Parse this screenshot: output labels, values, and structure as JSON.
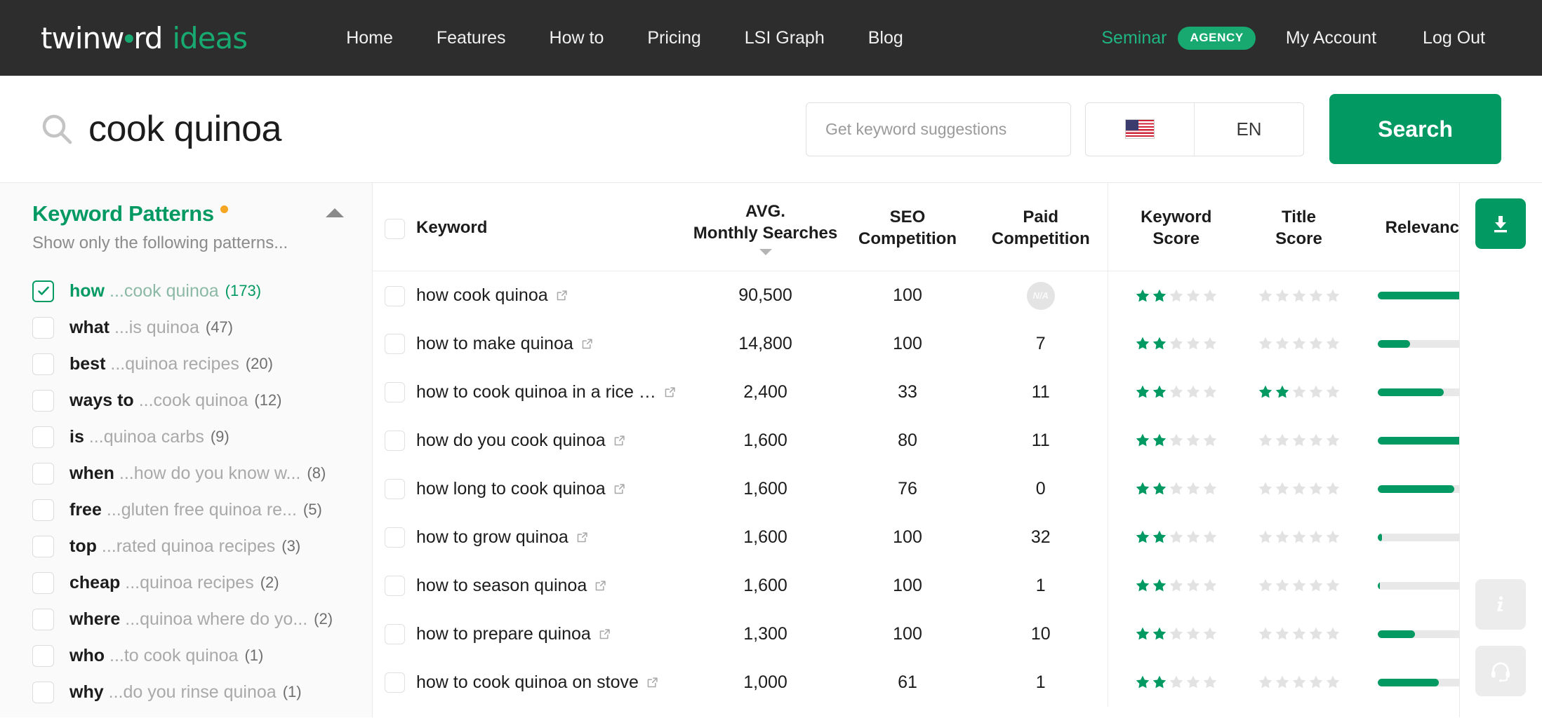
{
  "brand": {
    "logo_main": "twinw",
    "logo_o": "rd",
    "logo_suffix": "ideas"
  },
  "nav": {
    "items": [
      {
        "label": "Home"
      },
      {
        "label": "Features"
      },
      {
        "label": "How to"
      },
      {
        "label": "Pricing"
      },
      {
        "label": "LSI Graph"
      },
      {
        "label": "Blog"
      }
    ],
    "account_name": "Seminar",
    "account_badge": "AGENCY",
    "my_account": "My Account",
    "log_out": "Log Out"
  },
  "search": {
    "query": "cook quinoa",
    "suggestions_placeholder": "Get keyword suggestions",
    "language_code": "EN",
    "country_flag": "us-flag-icon",
    "search_button": "Search"
  },
  "sidebar": {
    "title": "Keyword Patterns",
    "subtitle": "Show only the following patterns...",
    "patterns": [
      {
        "prefix": "how",
        "suffix": "...cook quinoa",
        "count": "(173)",
        "checked": true
      },
      {
        "prefix": "what",
        "suffix": "...is quinoa",
        "count": "(47)",
        "checked": false
      },
      {
        "prefix": "best",
        "suffix": "...quinoa recipes",
        "count": "(20)",
        "checked": false
      },
      {
        "prefix": "ways to",
        "suffix": "...cook quinoa",
        "count": "(12)",
        "checked": false
      },
      {
        "prefix": "is",
        "suffix": "...quinoa carbs",
        "count": "(9)",
        "checked": false
      },
      {
        "prefix": "when",
        "suffix": "...how do you know w...",
        "count": "(8)",
        "checked": false
      },
      {
        "prefix": "free",
        "suffix": "...gluten free quinoa re...",
        "count": "(5)",
        "checked": false
      },
      {
        "prefix": "top",
        "suffix": "...rated quinoa recipes",
        "count": "(3)",
        "checked": false
      },
      {
        "prefix": "cheap",
        "suffix": "...quinoa recipes",
        "count": "(2)",
        "checked": false
      },
      {
        "prefix": "where",
        "suffix": "...quinoa where do yo...",
        "count": "(2)",
        "checked": false
      },
      {
        "prefix": "who",
        "suffix": "...to cook quinoa",
        "count": "(1)",
        "checked": false
      },
      {
        "prefix": "why",
        "suffix": "...do you rinse quinoa",
        "count": "(1)",
        "checked": false
      }
    ]
  },
  "table": {
    "headers": {
      "keyword": "Keyword",
      "avg_line1": "AVG.",
      "avg_line2": "Monthly Searches",
      "seo_line1": "SEO",
      "seo_line2": "Competition",
      "paid_line1": "Paid",
      "paid_line2": "Competition",
      "kscore_line1": "Keyword",
      "kscore_line2": "Score",
      "tscore_line1": "Title",
      "tscore_line2": "Score",
      "relevance": "Relevance"
    },
    "sorted_by": "AVG. Monthly Searches",
    "sort_direction": "desc",
    "rows": [
      {
        "keyword": "how cook quinoa",
        "avg": "90,500",
        "seo": "100",
        "paid": "N/A",
        "paid_na": true,
        "kscore": 2,
        "tscore": 0,
        "relevance": 100
      },
      {
        "keyword": "how to make quinoa",
        "avg": "14,800",
        "seo": "100",
        "paid": "7",
        "paid_na": false,
        "kscore": 2,
        "tscore": 0,
        "relevance": 33
      },
      {
        "keyword": "how to cook quinoa in a rice …",
        "avg": "2,400",
        "seo": "33",
        "paid": "11",
        "paid_na": false,
        "kscore": 2,
        "tscore": 2,
        "relevance": 67
      },
      {
        "keyword": "how do you cook quinoa",
        "avg": "1,600",
        "seo": "80",
        "paid": "11",
        "paid_na": false,
        "kscore": 2,
        "tscore": 0,
        "relevance": 100
      },
      {
        "keyword": "how long to cook quinoa",
        "avg": "1,600",
        "seo": "76",
        "paid": "0",
        "paid_na": false,
        "kscore": 2,
        "tscore": 0,
        "relevance": 78
      },
      {
        "keyword": "how to grow quinoa",
        "avg": "1,600",
        "seo": "100",
        "paid": "32",
        "paid_na": false,
        "kscore": 2,
        "tscore": 0,
        "relevance": 4
      },
      {
        "keyword": "how to season quinoa",
        "avg": "1,600",
        "seo": "100",
        "paid": "1",
        "paid_na": false,
        "kscore": 2,
        "tscore": 0,
        "relevance": 2
      },
      {
        "keyword": "how to prepare quinoa",
        "avg": "1,300",
        "seo": "100",
        "paid": "10",
        "paid_na": false,
        "kscore": 2,
        "tscore": 0,
        "relevance": 38
      },
      {
        "keyword": "how to cook quinoa on stove",
        "avg": "1,000",
        "seo": "61",
        "paid": "1",
        "paid_na": false,
        "kscore": 2,
        "tscore": 0,
        "relevance": 62
      }
    ]
  },
  "rail": {
    "download_icon": "download-icon",
    "info_icon": "info-icon",
    "support_icon": "headset-icon"
  }
}
